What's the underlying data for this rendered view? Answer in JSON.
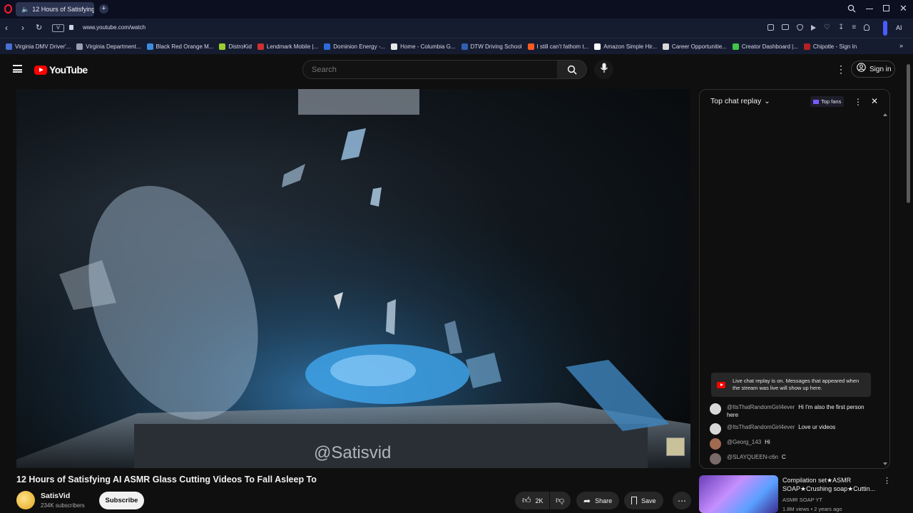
{
  "browser": {
    "tab_title": "12 Hours of Satisfying",
    "url": "www.youtube.com/watch",
    "url_badge": "V",
    "ai_label": "AI"
  },
  "bookmarks": [
    {
      "label": "Virginia DMV Driver'...",
      "color": "#4a6fd0"
    },
    {
      "label": "Virginia Department...",
      "color": "#9aa0b0"
    },
    {
      "label": "Black Red Orange M...",
      "color": "#3c8de0"
    },
    {
      "label": "DistroKid",
      "color": "#9acd32"
    },
    {
      "label": "Lendmark Mobile |...",
      "color": "#d03030"
    },
    {
      "label": "Dominion Energy -...",
      "color": "#2d6bd8"
    },
    {
      "label": "Home - Columbia G...",
      "color": "#e8e8e8"
    },
    {
      "label": "DTW Driving School",
      "color": "#2f5fb0"
    },
    {
      "label": "I still can't fathom t...",
      "color": "#ff5a1f"
    },
    {
      "label": "Amazon Simple Hir...",
      "color": "#ffffff"
    },
    {
      "label": "Career Opportunitie...",
      "color": "#d8d8d8"
    },
    {
      "label": "Creator Dashboard |...",
      "color": "#42c44a"
    },
    {
      "label": "Chipotle - Sign In",
      "color": "#b22222"
    }
  ],
  "youtube": {
    "logo_text": "YouTube",
    "search_placeholder": "Search",
    "sign_in": "Sign in"
  },
  "video": {
    "watermark": "@Satisvid",
    "title": "12 Hours of Satisfying AI ASMR Glass Cutting Videos To Fall Asleep To",
    "channel_name": "SatisVid",
    "subscribers": "234K subscribers",
    "subscribe": "Subscribe",
    "likes": "2K",
    "share": "Share",
    "save": "Save"
  },
  "chat": {
    "header": "Top chat replay",
    "top_fans": "Top fans",
    "notice": "Live chat replay is on. Messages that appeared when the stream was live will show up here.",
    "messages": [
      {
        "user": "@ItsThatRandomGirl4ever",
        "text": "Hi I'm also the first person here"
      },
      {
        "user": "@ItsThatRandomGirl4ever",
        "text": "Love ur videos"
      },
      {
        "user": "@Georg_143",
        "text": "Hi"
      },
      {
        "user": "@SLAYQUEEN-c6n",
        "text": "C"
      }
    ]
  },
  "recommended": {
    "title": "Compilation set★ASMR SOAP★Crushing soap★Cuttin...",
    "channel": "ASMR SOAP YT",
    "meta": "1.8M views • 2 years ago"
  },
  "colors": {
    "accent_red": "#ff0000",
    "subscribe_bg": "#f1f1f1",
    "chat_bg": "#0f0f0f"
  }
}
